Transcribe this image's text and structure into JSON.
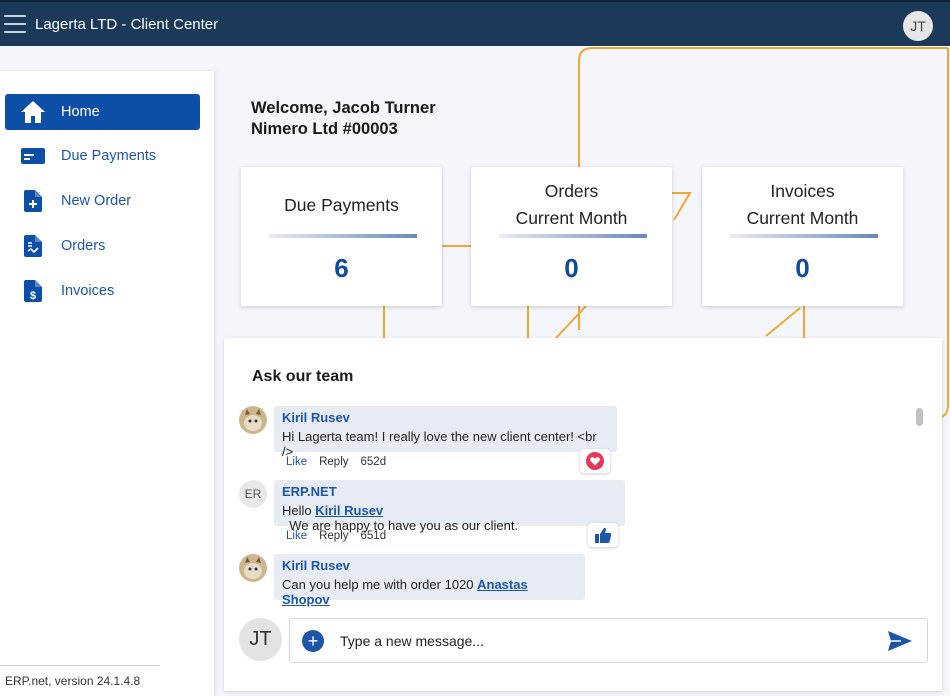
{
  "app": {
    "title": "Lagerta LTD - Client Center",
    "user_initials": "JT"
  },
  "sidebar": {
    "items": [
      {
        "label": "Home",
        "icon": "home-icon",
        "active": true
      },
      {
        "label": "Due Payments",
        "icon": "payment-card-icon",
        "active": false
      },
      {
        "label": "New Order",
        "icon": "new-document-icon",
        "active": false
      },
      {
        "label": "Orders",
        "icon": "orders-document-icon",
        "active": false
      },
      {
        "label": "Invoices",
        "icon": "invoice-dollar-icon",
        "active": false
      }
    ],
    "version": "ERP.net, version 24.1.4.8"
  },
  "welcome": {
    "line1": "Welcome, Jacob Turner",
    "line2": "Nimero Ltd #00003"
  },
  "cards": [
    {
      "title1": "Due Payments",
      "title2": "",
      "value": "6"
    },
    {
      "title1": "Orders",
      "title2": "Current Month",
      "value": "0"
    },
    {
      "title1": "Invoices",
      "title2": "Current Month",
      "value": "0"
    }
  ],
  "chat": {
    "title": "Ask our team",
    "messages": [
      {
        "author": "Kiril Rusev",
        "avatar": "cat-photo",
        "text": "Hi Lagerta team! I really love the new client center! <br />",
        "like": "Like",
        "reply": "Reply",
        "age": "652d",
        "reaction": "heart-icon"
      },
      {
        "author": "ERP.NET",
        "avatar_initials": "ER",
        "text_pre": "Hello ",
        "mention": "Kiril Rusev",
        "text_post": "  We are happy to have you as our client.",
        "like": "Like",
        "reply": "Reply",
        "age": "651d",
        "reaction": "thumbs-up-icon"
      },
      {
        "author": "Kiril Rusev",
        "avatar": "cat-photo",
        "text_pre": "Can you help me with order 1020 ",
        "mention": "Anastas Shopov"
      }
    ],
    "current_user_initials": "JT",
    "composer_placeholder": "Type a new message..."
  },
  "colors": {
    "topbar": "#1b3a5a",
    "accent": "#0d4ea6",
    "decoration": "#f0a830"
  }
}
